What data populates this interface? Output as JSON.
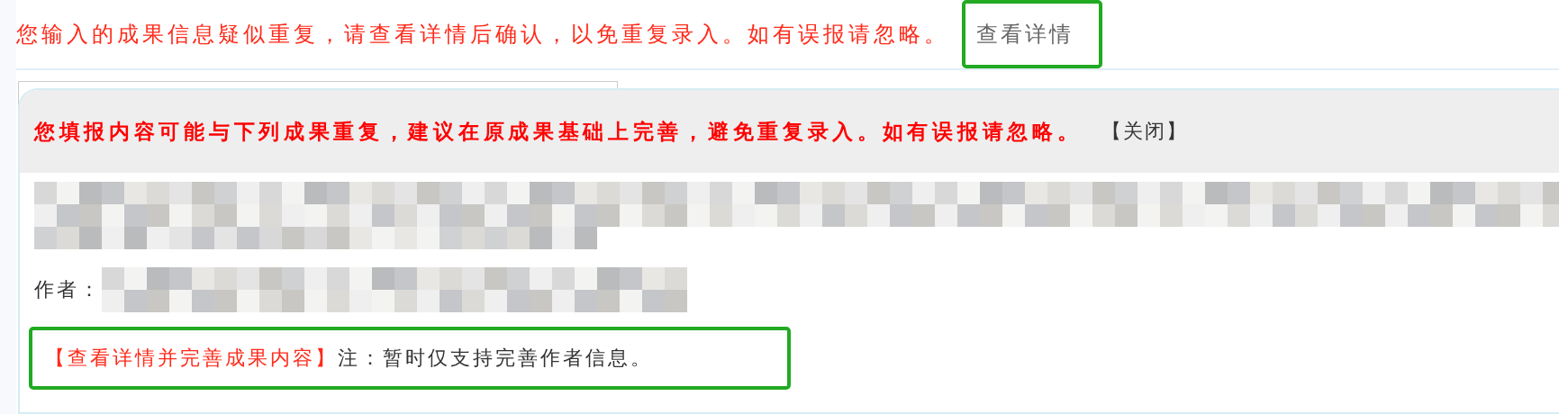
{
  "notice": {
    "message": "您输入的成果信息疑似重复，请查看详情后确认，以免重复录入。如有误报请忽略。",
    "details_link": "查看详情"
  },
  "popup": {
    "message": "您填报内容可能与下列成果重复，建议在原成果基础上完善，避免重复录入。如有误报请忽略。",
    "close": "【关闭】",
    "author_label": "作者：",
    "details_link": "【查看详情并完善成果内容】",
    "note": "注：暂时仅支持完善作者信息。"
  }
}
